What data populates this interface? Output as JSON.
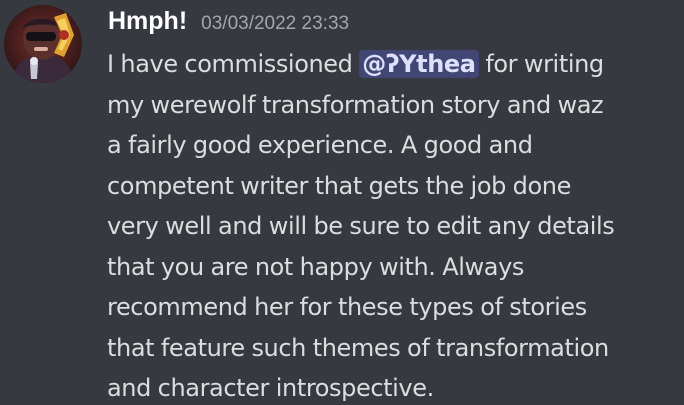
{
  "message": {
    "author": "Hmph!",
    "timestamp": "03/03/2022 23:33",
    "avatar_icon": "user-avatar",
    "mention": "@ʔYthea",
    "mention_color": "#414675",
    "body_lines": [
      {
        "before": "I have commissioned ",
        "after": " for writing"
      },
      {
        "text": "my werewolf transformation story and waz"
      },
      {
        "text": "a fairly good experience. A good and"
      },
      {
        "text": "competent writer that gets the job done"
      },
      {
        "text": "very well and will be sure to edit any details"
      },
      {
        "text": "that you are not happy with. Always"
      },
      {
        "text": "recommend her for these types of stories"
      },
      {
        "text": "that feature such themes of transformation"
      },
      {
        "text": "and character introspective."
      }
    ]
  },
  "theme": {
    "background": "#36393f",
    "username_color": "#ffffff",
    "text_color": "#dcddde",
    "timestamp_color": "#a3a6aa"
  }
}
